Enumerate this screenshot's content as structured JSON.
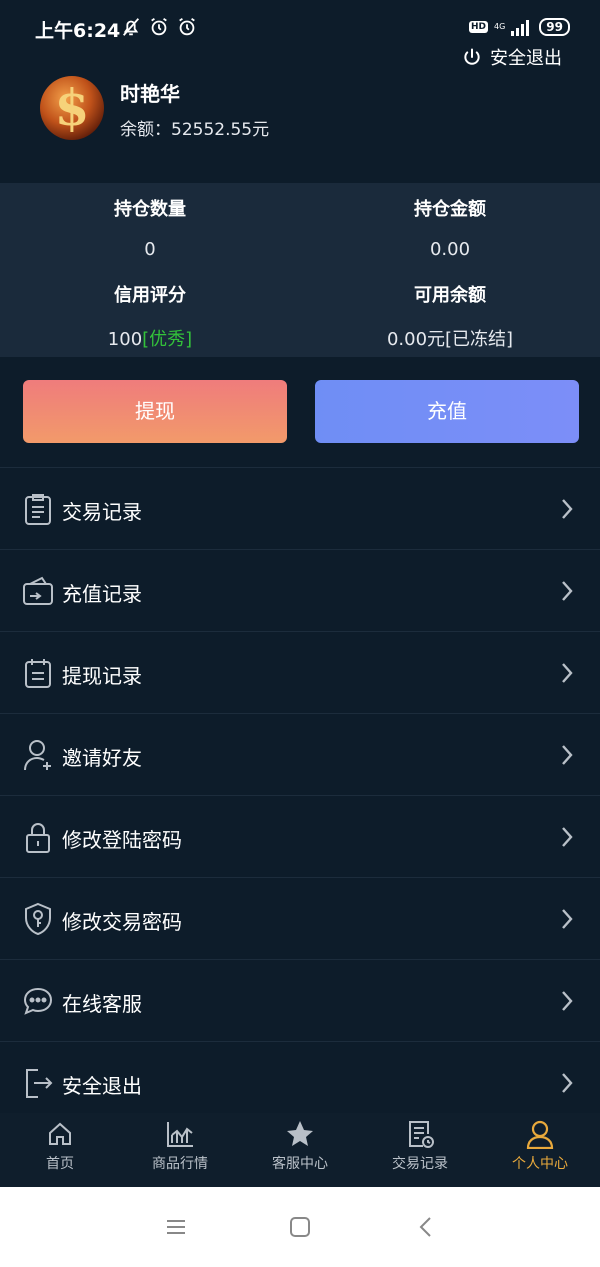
{
  "status_bar": {
    "time": "上午6:24",
    "hd": "HD",
    "network": "4G",
    "battery": "99"
  },
  "header": {
    "logout_label": "安全退出",
    "username": "时艳华",
    "balance_label": "余额：",
    "balance_value": "52552.55元"
  },
  "stats": {
    "position_count_label": "持仓数量",
    "position_count_value": "0",
    "position_amount_label": "持仓金额",
    "position_amount_value": "0.00",
    "credit_label": "信用评分",
    "credit_value": "100",
    "credit_rating": "[优秀]",
    "available_label": "可用余额",
    "available_value": "0.00元[已冻结]"
  },
  "actions": {
    "withdraw": "提现",
    "recharge": "充值"
  },
  "menu": [
    {
      "label": "交易记录",
      "icon": "clipboard-icon"
    },
    {
      "label": "充值记录",
      "icon": "wallet-icon"
    },
    {
      "label": "提现记录",
      "icon": "calendar-icon"
    },
    {
      "label": "邀请好友",
      "icon": "add-user-icon"
    },
    {
      "label": "修改登陆密码",
      "icon": "lock-icon"
    },
    {
      "label": "修改交易密码",
      "icon": "shield-key-icon"
    },
    {
      "label": "在线客服",
      "icon": "chat-icon"
    },
    {
      "label": "安全退出",
      "icon": "exit-icon"
    }
  ],
  "tabbar": [
    {
      "label": "首页",
      "icon": "home-icon"
    },
    {
      "label": "商品行情",
      "icon": "chart-icon"
    },
    {
      "label": "客服中心",
      "icon": "star-icon"
    },
    {
      "label": "交易记录",
      "icon": "document-clock-icon"
    },
    {
      "label": "个人中心",
      "icon": "person-icon",
      "active": true
    }
  ],
  "colors": {
    "background": "#0d1c2a",
    "stats_background": "#1a2a3b",
    "accent_active": "#e8a93c",
    "good_green": "#33c23a",
    "frozen_red": "#d62424"
  }
}
